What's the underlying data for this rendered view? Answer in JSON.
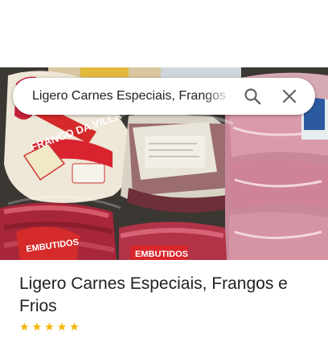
{
  "search": {
    "query": "Ligero Carnes Especiais, Frangos e Frios"
  },
  "place": {
    "title": "Ligero Carnes Especiais, Frangos e Frios"
  },
  "photo": {
    "package_text_frango": "FRANGO DA VILLA",
    "package_text_embutidos": "EMBUTIDOS",
    "package_text_embutidos_2": "EMBUTIDOS"
  },
  "colors": {
    "accent": "#f4b400",
    "text_primary": "#202124",
    "icon": "#5f6368"
  },
  "icons": [
    "search-icon",
    "close-icon",
    "star-icon"
  ]
}
